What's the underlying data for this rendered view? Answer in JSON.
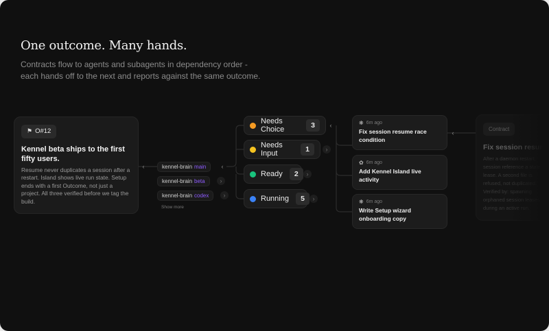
{
  "header": {
    "title": "One outcome. Many hands.",
    "subtitle_lines": [
      "Contracts flow to agents and subagents in dependency order -",
      "each hands off to the next and reports against the same outcome."
    ]
  },
  "outcome": {
    "tag": "O#12",
    "title": "Kennel beta ships to the first fifty users.",
    "body": "Resume never duplicates a session after a restart. Island shows live run state. Setup ends with a first Outcome, not just a project. All three verified before we tag the build."
  },
  "branches": [
    {
      "repo": "kennel-brain",
      "agent": "main"
    },
    {
      "repo": "kennel-brain",
      "agent": "beta"
    },
    {
      "repo": "kennel-brain",
      "agent": "codex"
    }
  ],
  "show_more": "Show more",
  "statuses": [
    {
      "label": "Needs Choice",
      "count": "3",
      "color": "#f59b23"
    },
    {
      "label": "Needs Input",
      "count": "1",
      "color": "#f5c320"
    },
    {
      "label": "Ready",
      "count": "2",
      "color": "#19c37d"
    },
    {
      "label": "Running",
      "count": "5",
      "color": "#3b82f6"
    }
  ],
  "tasks": [
    {
      "time": "6m ago",
      "icon": "claude-icon",
      "title": "Fix session resume race condition"
    },
    {
      "time": "6m ago",
      "icon": "openai-icon",
      "title": "Add Kennel Island live activity"
    },
    {
      "time": "6m ago",
      "icon": "claude-icon",
      "title": "Write Setup wizard onboarding copy"
    }
  ],
  "contract": {
    "tag": "Contract",
    "title": "Fix session resume",
    "body_lines": [
      "After a daemon restart,",
      "session reference a stale",
      "lease. A second file is",
      "refused, not duplicated.",
      "Verified by: spawning",
      "orphaned session leases",
      "during an active run."
    ]
  }
}
